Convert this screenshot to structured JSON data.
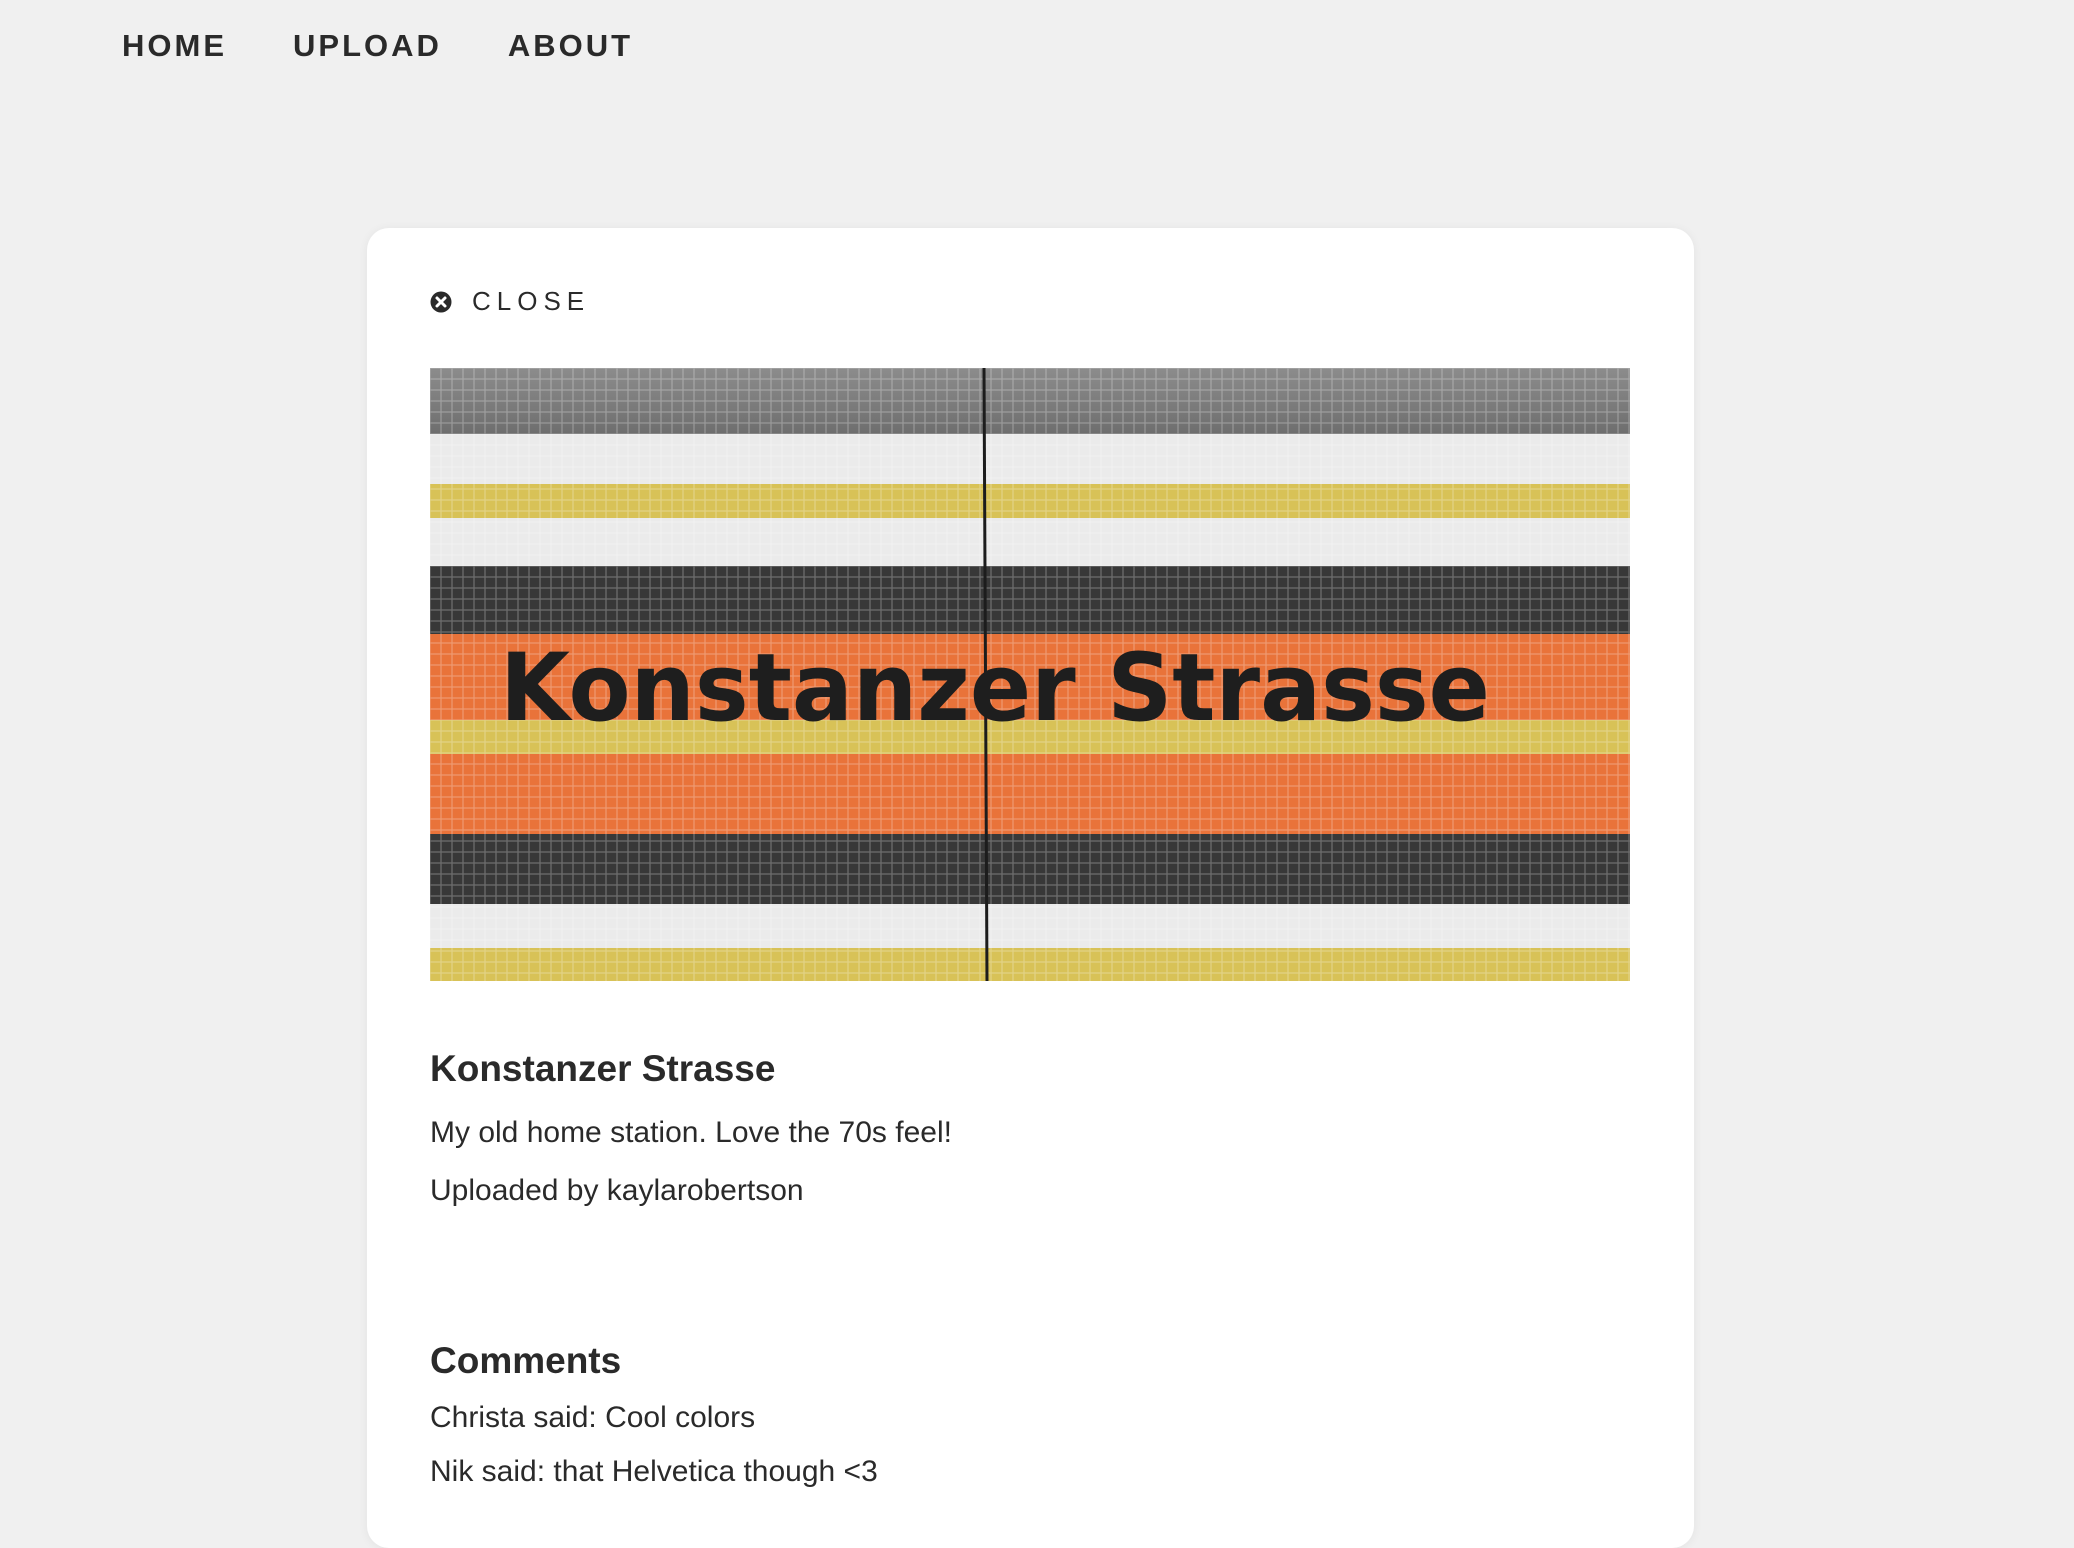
{
  "nav": {
    "items": [
      {
        "label": "HOME"
      },
      {
        "label": "UPLOAD"
      },
      {
        "label": "ABOUT"
      }
    ]
  },
  "modal": {
    "close_label": "CLOSE",
    "photo": {
      "sign_text": "Konstanzer Strasse",
      "title": "Konstanzer Strasse",
      "description": "My old home station. Love the 70s feel!",
      "uploaded_by": "Uploaded by kaylarobertson"
    },
    "comments": {
      "heading": "Comments",
      "items": [
        {
          "text": "Christa said: Cool colors"
        },
        {
          "text": "Nik said: that Helvetica though <3"
        }
      ]
    }
  },
  "colors": {
    "background": "#f0f0f0",
    "card": "#ffffff",
    "text": "#2a2a2a",
    "tile_orange": "#e9733a",
    "tile_yellow": "#d8c257",
    "tile_dark": "#383838",
    "tile_white": "#ebebeb",
    "tile_gray": "#7a7a7a"
  }
}
